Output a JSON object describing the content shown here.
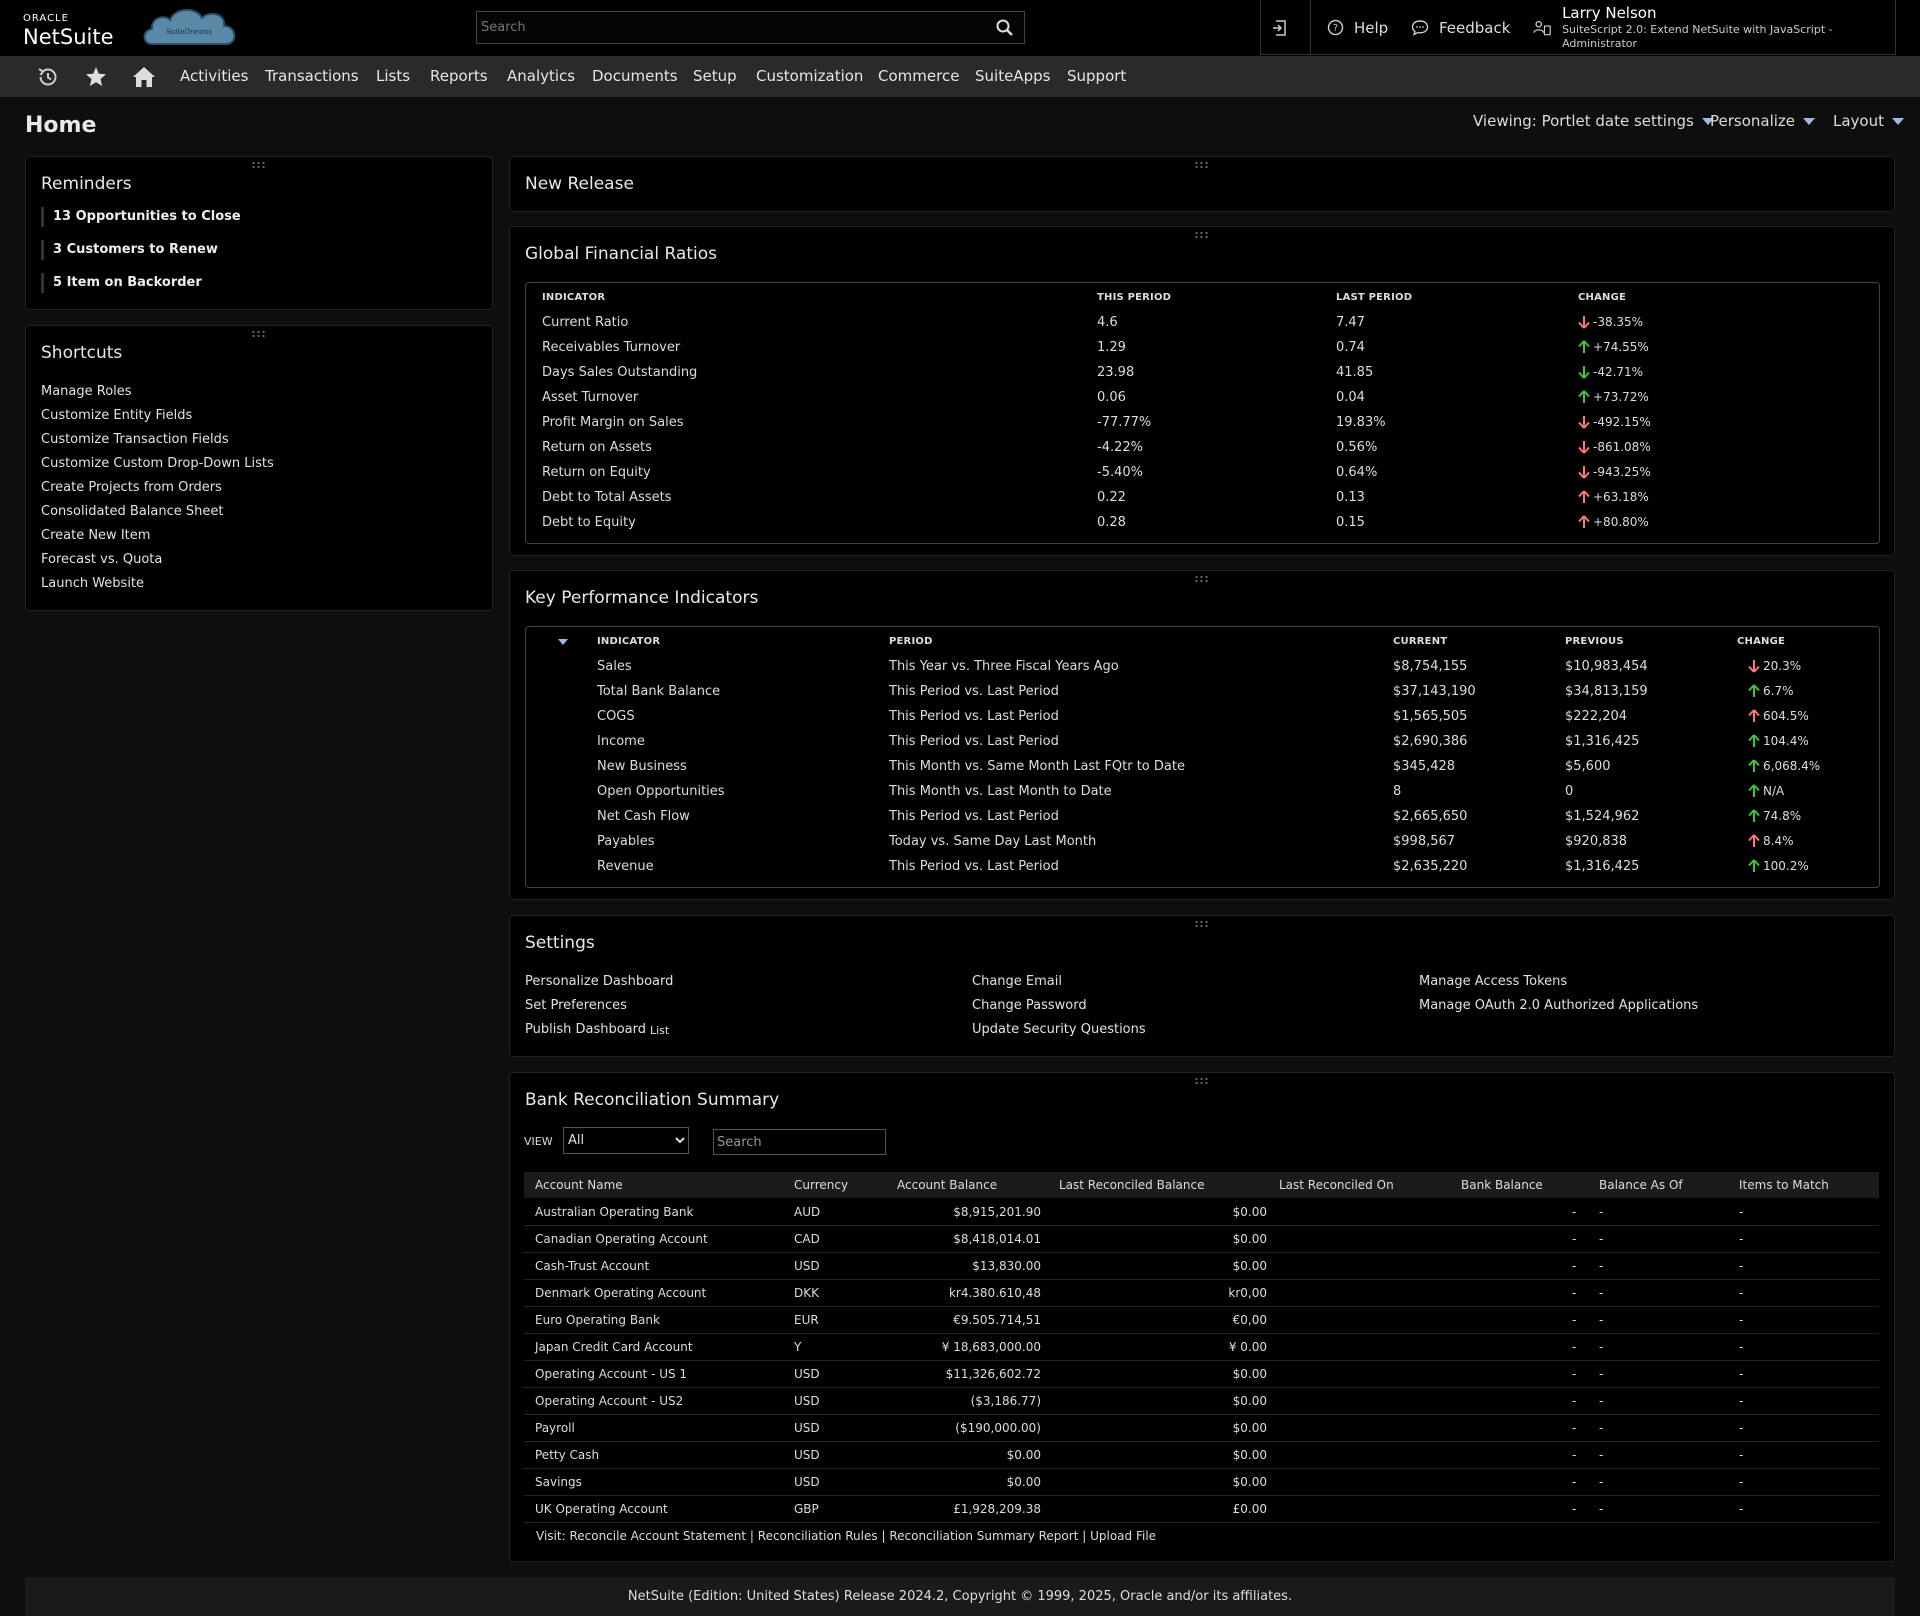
{
  "branding": {
    "oracle": "ORACLE",
    "netsuite": "NetSuite",
    "logo_text": "SuiteDreams"
  },
  "search": {
    "placeholder": "Search"
  },
  "top_right": {
    "help": "Help",
    "feedback": "Feedback",
    "user_name": "Larry Nelson",
    "user_role": "SuiteScript 2.0: Extend NetSuite with JavaScript - Administrator"
  },
  "nav": {
    "items": [
      "Activities",
      "Transactions",
      "Lists",
      "Reports",
      "Analytics",
      "Documents",
      "Setup",
      "Customization",
      "Commerce",
      "SuiteApps",
      "Support"
    ]
  },
  "page": {
    "title": "Home",
    "viewing": "Viewing: Portlet date settings",
    "personalize": "Personalize",
    "layout": "Layout"
  },
  "reminders": {
    "title": "Reminders",
    "items": [
      {
        "count": "13",
        "label": "Opportunities to Close"
      },
      {
        "count": "3",
        "label": "Customers to Renew"
      },
      {
        "count": "5",
        "label": "Item on Backorder"
      }
    ]
  },
  "shortcuts": {
    "title": "Shortcuts",
    "items": [
      "Manage Roles",
      "Customize Entity Fields",
      "Customize Transaction Fields",
      "Customize Custom Drop-Down Lists",
      "Create Projects from Orders",
      "Consolidated Balance Sheet",
      "Create New Item",
      "Forecast vs. Quota",
      "Launch Website"
    ]
  },
  "new_release": {
    "title": "New Release"
  },
  "ratios": {
    "title": "Global Financial Ratios",
    "headers": [
      "INDICATOR",
      "THIS PERIOD",
      "LAST PERIOD",
      "CHANGE"
    ],
    "rows": [
      {
        "indicator": "Current Ratio",
        "this": "4.6",
        "last": "7.47",
        "change": "-38.35%",
        "arrow": "down",
        "color": "#ff7676"
      },
      {
        "indicator": "Receivables Turnover",
        "this": "1.29",
        "last": "0.74",
        "change": "+74.55%",
        "arrow": "up",
        "color": "#3ec43e"
      },
      {
        "indicator": "Days Sales Outstanding",
        "this": "23.98",
        "last": "41.85",
        "change": "-42.71%",
        "arrow": "down",
        "color": "#3ec43e"
      },
      {
        "indicator": "Asset Turnover",
        "this": "0.06",
        "last": "0.04",
        "change": "+73.72%",
        "arrow": "up",
        "color": "#3ec43e"
      },
      {
        "indicator": "Profit Margin on Sales",
        "this": "-77.77%",
        "last": "19.83%",
        "change": "-492.15%",
        "arrow": "down",
        "color": "#ff7676"
      },
      {
        "indicator": "Return on Assets",
        "this": "-4.22%",
        "last": "0.56%",
        "change": "-861.08%",
        "arrow": "down",
        "color": "#ff7676"
      },
      {
        "indicator": "Return on Equity",
        "this": "-5.40%",
        "last": "0.64%",
        "change": "-943.25%",
        "arrow": "down",
        "color": "#ff7676"
      },
      {
        "indicator": "Debt to Total Assets",
        "this": "0.22",
        "last": "0.13",
        "change": "+63.18%",
        "arrow": "up",
        "color": "#ff7676"
      },
      {
        "indicator": "Debt to Equity",
        "this": "0.28",
        "last": "0.15",
        "change": "+80.80%",
        "arrow": "up",
        "color": "#ff7676"
      }
    ]
  },
  "kpi": {
    "title": "Key Performance Indicators",
    "headers": [
      "INDICATOR",
      "PERIOD",
      "CURRENT",
      "PREVIOUS",
      "CHANGE"
    ],
    "rows": [
      {
        "indicator": "Sales",
        "period": "This Year vs. Three Fiscal Years Ago",
        "current": "$8,754,155",
        "previous": "$10,983,454",
        "change": "20.3%",
        "arrow": "down",
        "color": "#ff7676"
      },
      {
        "indicator": "Total Bank Balance",
        "period": "This Period vs. Last Period",
        "current": "$37,143,190",
        "previous": "$34,813,159",
        "change": "6.7%",
        "arrow": "up",
        "color": "#3ec43e"
      },
      {
        "indicator": "COGS",
        "period": "This Period vs. Last Period",
        "current": "$1,565,505",
        "previous": "$222,204",
        "change": "604.5%",
        "arrow": "up",
        "color": "#ff7676"
      },
      {
        "indicator": "Income",
        "period": "This Period vs. Last Period",
        "current": "$2,690,386",
        "previous": "$1,316,425",
        "change": "104.4%",
        "arrow": "up",
        "color": "#3ec43e"
      },
      {
        "indicator": "New Business",
        "period": "This Month vs. Same Month Last FQtr to Date",
        "current": "$345,428",
        "previous": "$5,600",
        "change": "6,068.4%",
        "arrow": "up",
        "color": "#3ec43e"
      },
      {
        "indicator": "Open Opportunities",
        "period": "This Month vs. Last Month to Date",
        "current": "8",
        "previous": "0",
        "change": "N/A",
        "arrow": "up",
        "color": "#3ec43e"
      },
      {
        "indicator": "Net Cash Flow",
        "period": "This Period vs. Last Period",
        "current": "$2,665,650",
        "previous": "$1,524,962",
        "change": "74.8%",
        "arrow": "up",
        "color": "#3ec43e"
      },
      {
        "indicator": "Payables",
        "period": "Today vs. Same Day Last Month",
        "current": "$998,567",
        "previous": "$920,838",
        "change": "8.4%",
        "arrow": "up",
        "color": "#ff7676"
      },
      {
        "indicator": "Revenue",
        "period": "This Period vs. Last Period",
        "current": "$2,635,220",
        "previous": "$1,316,425",
        "change": "100.2%",
        "arrow": "up",
        "color": "#3ec43e"
      }
    ]
  },
  "settings": {
    "title": "Settings",
    "col1": [
      "Personalize Dashboard",
      "Set Preferences",
      "Publish Dashboard"
    ],
    "list_tag": "List",
    "col2": [
      "Change Email",
      "Change Password",
      "Update Security Questions"
    ],
    "col3": [
      "Manage Access Tokens",
      "Manage OAuth 2.0 Authorized Applications"
    ]
  },
  "bank": {
    "title": "Bank Reconciliation Summary",
    "view_label": "VIEW",
    "view_value": "All",
    "search_placeholder": "Search",
    "headers": [
      "Account Name",
      "Currency",
      "Account Balance",
      "Last Reconciled Balance",
      "Last Reconciled On",
      "Bank Balance",
      "Balance As Of",
      "Items to Match"
    ],
    "rows": [
      {
        "name": "Australian Operating Bank",
        "cur": "AUD",
        "bal": "$8,915,201.90",
        "last": "$0.00"
      },
      {
        "name": "Canadian Operating Account",
        "cur": "CAD",
        "bal": "$8,418,014.01",
        "last": "$0.00"
      },
      {
        "name": "Cash-Trust Account",
        "cur": "USD",
        "bal": "$13,830.00",
        "last": "$0.00"
      },
      {
        "name": "Denmark Operating Account",
        "cur": "DKK",
        "bal": "kr4.380.610,48",
        "last": "kr0,00"
      },
      {
        "name": "Euro Operating Bank",
        "cur": "EUR",
        "bal": "€9.505.714,51",
        "last": "€0,00"
      },
      {
        "name": "Japan Credit Card Account",
        "cur": "Y",
        "bal": "¥ 18,683,000.00",
        "last": "¥ 0.00"
      },
      {
        "name": "Operating Account - US 1",
        "cur": "USD",
        "bal": "$11,326,602.72",
        "last": "$0.00"
      },
      {
        "name": "Operating Account - US2",
        "cur": "USD",
        "bal": "($3,186.77)",
        "last": "$0.00"
      },
      {
        "name": "Payroll",
        "cur": "USD",
        "bal": "($190,000.00)",
        "last": "$0.00"
      },
      {
        "name": "Petty Cash",
        "cur": "USD",
        "bal": "$0.00",
        "last": "$0.00"
      },
      {
        "name": "Savings",
        "cur": "USD",
        "bal": "$0.00",
        "last": "$0.00"
      },
      {
        "name": "UK Operating Account",
        "cur": "GBP",
        "bal": "£1,928,209.38",
        "last": "£0.00"
      }
    ],
    "dash": "-",
    "visit_prefix": "Visit:",
    "visit_links": [
      "Reconcile Account Statement",
      "Reconciliation Rules",
      "Reconciliation Summary Report",
      "Upload File"
    ],
    "sep": "|"
  },
  "footer": {
    "text": "NetSuite (Edition: United States) Release 2024.2, Copyright © 1999, 2025, Oracle and/or its affiliates."
  },
  "colors": {
    "up_good": "#3ec43e",
    "bad": "#ff7676",
    "caret": "#9fb8e8"
  }
}
